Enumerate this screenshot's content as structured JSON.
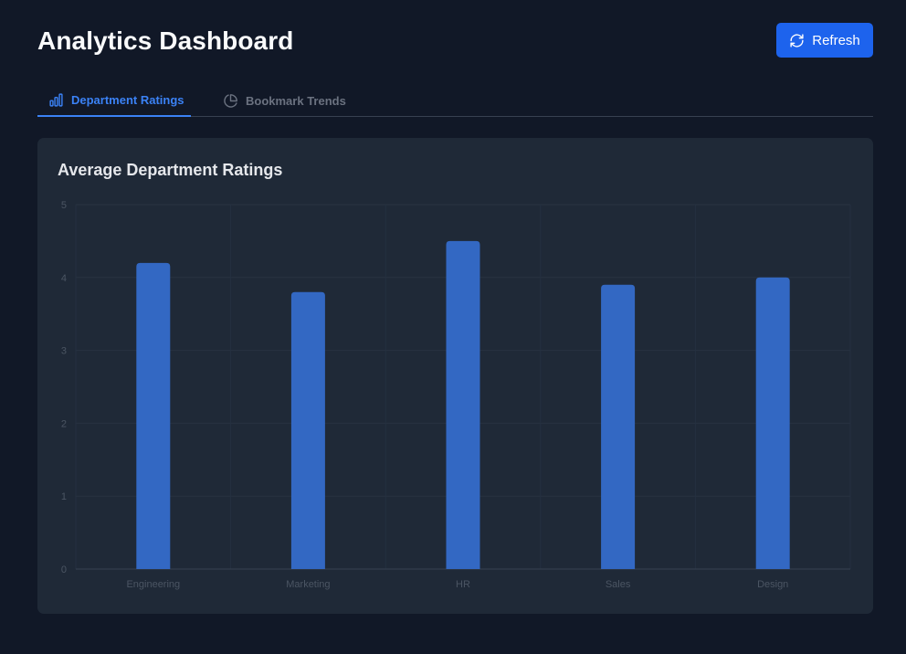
{
  "header": {
    "title": "Analytics Dashboard",
    "refresh_label": "Refresh"
  },
  "tabs": [
    {
      "label": "Department Ratings",
      "icon": "bar-chart-icon",
      "active": true
    },
    {
      "label": "Bookmark Trends",
      "icon": "pie-chart-icon",
      "active": false
    }
  ],
  "card": {
    "title": "Average Department Ratings"
  },
  "colors": {
    "background": "#111827",
    "card": "#1f2937",
    "accent": "#3b82f6",
    "button": "#1d63ed",
    "bar": "#3368c3"
  },
  "chart_data": {
    "type": "bar",
    "categories": [
      "Engineering",
      "Marketing",
      "HR",
      "Sales",
      "Design"
    ],
    "values": [
      4.2,
      3.8,
      4.5,
      3.9,
      4.0
    ],
    "ylim": [
      0,
      5
    ],
    "yticks": [
      0,
      1,
      2,
      3,
      4,
      5
    ],
    "grid": true,
    "legend": "none"
  }
}
